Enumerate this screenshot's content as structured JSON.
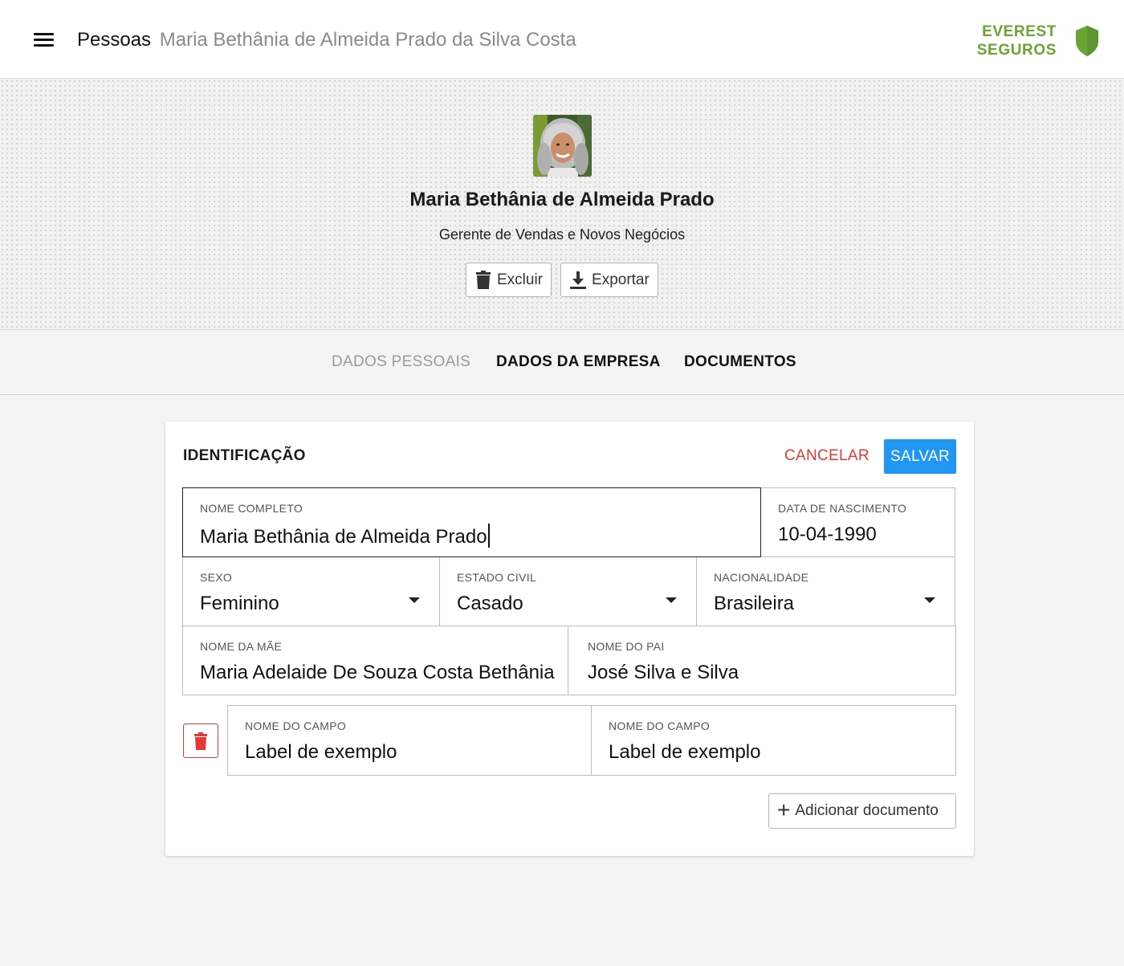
{
  "header": {
    "section": "Pessoas",
    "current": "Maria Bethânia de Almeida Prado da Silva Costa",
    "brand_line1": "EVEREST",
    "brand_line2": "SEGUROS",
    "brand_color": "#6aa533"
  },
  "profile": {
    "name": "Maria Bethânia de Almeida Prado",
    "role": "Gerente de Vendas e Novos Negócios",
    "delete_label": "Excluir",
    "export_label": "Exportar"
  },
  "tabs": [
    {
      "label": "DADOS PESSOAIS"
    },
    {
      "label": "DADOS DA EMPRESA"
    },
    {
      "label": "DOCUMENTOS"
    }
  ],
  "card": {
    "title": "IDENTIFICAÇÃO",
    "cancel_label": "CANCELAR",
    "save_label": "SALVAR",
    "accent_color": "#2196f3",
    "danger_color": "#e53935",
    "fields": {
      "full_name": {
        "label": "NOME COMPLETO",
        "value": "Maria Bethânia de Almeida Prado"
      },
      "birth_date": {
        "label": "DATA DE NASCIMENTO",
        "value": "10-04-1990"
      },
      "sex": {
        "label": "SEXO",
        "value": "Feminino"
      },
      "marital_status": {
        "label": "ESTADO CIVIL",
        "value": "Casado"
      },
      "nationality": {
        "label": "NACIONALIDADE",
        "value": "Brasileira"
      },
      "mother_name": {
        "label": "NOME DA MÃE",
        "value": "Maria Adelaide De Souza Costa Bethânia"
      },
      "father_name": {
        "label": "NOME DO PAI",
        "value": "José Silva e Silva"
      }
    },
    "custom_fields": [
      {
        "label": "NOME DO CAMPO",
        "value": "Label de exemplo"
      },
      {
        "label": "NOME DO CAMPO",
        "value": "Label de exemplo"
      }
    ],
    "add_document_label": "Adicionar documento"
  },
  "icons": [
    "menu-icon",
    "shield-icon",
    "trash-icon",
    "download-icon",
    "chevron-down-icon",
    "plus-icon"
  ]
}
